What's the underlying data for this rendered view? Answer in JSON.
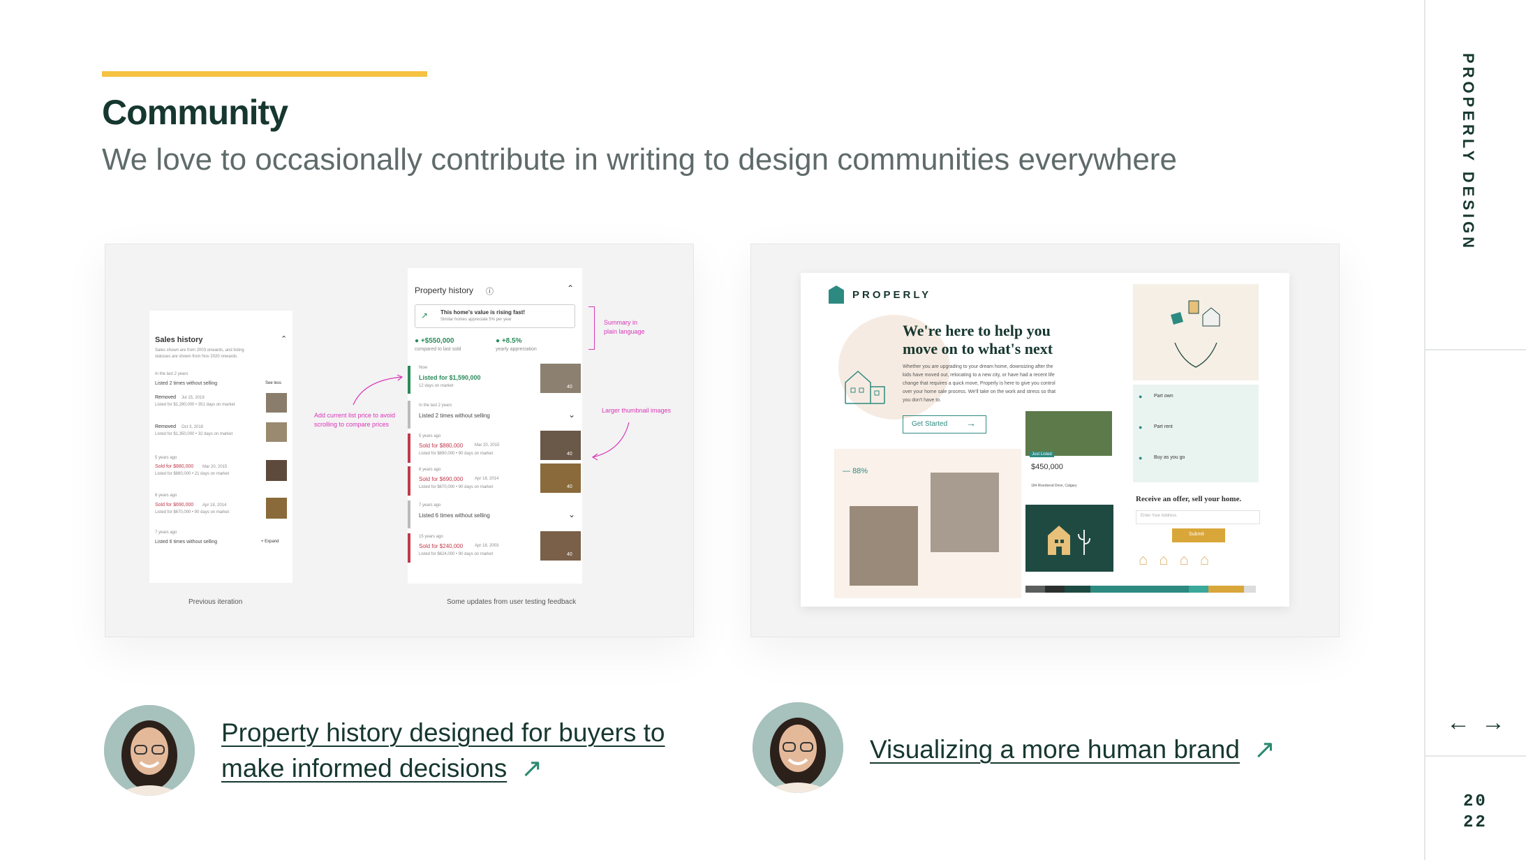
{
  "header": {
    "title": "Community",
    "subtitle": "We love to occasionally contribute in writing to design communities everywhere"
  },
  "sidebar": {
    "brand": "PROPERLY DESIGN",
    "prev_icon": "arrow-left-icon",
    "next_icon": "arrow-right-icon",
    "year_top": "20",
    "year_bottom": "22"
  },
  "articles": [
    {
      "link_line1": "Property history designed for buyers to",
      "link_line2": "make informed decisions",
      "icon": "arrow-up-right-icon"
    },
    {
      "link_line1": "Visualizing a more human brand",
      "icon": "arrow-up-right-icon"
    }
  ],
  "left_card": {
    "sales_history": {
      "title": "Sales history",
      "desc1": "Sales shown are from 2003 onwards, and listing",
      "desc2": "statuses are shown from Nov 2020 onwards.",
      "last2": "In the last 2 years",
      "listed2": "Listed 2 times without selling",
      "see_less": "See less",
      "removed1": "Removed",
      "removed1_date": "Jul 15, 2019",
      "removed1_detail": "Listed for $1,290,000 • 351 days on market",
      "removed2": "Removed",
      "removed2_date": "Oct 3, 2018",
      "removed2_detail": "Listed for $1,350,000 • 32 days on market",
      "ago5": "5 years ago",
      "sold1": "Sold for $880,000",
      "sold1_date": "Mar 20, 2015",
      "sold1_detail": "Listed for $880,000 • 21 days on market",
      "ago6": "6 years ago",
      "sold2": "Sold for $690,000",
      "sold2_date": "Apr 18, 2014",
      "sold2_detail": "Listed for $670,000 • 90 days on market",
      "ago7": "7 years ago",
      "listed6": "Listed 6 times without selling",
      "expand": "Expand"
    },
    "property_history": {
      "title": "Property history",
      "rising": "This home's value is rising fast!",
      "similar": "Similar homes appreciate 5% per year",
      "gain": "+$550,000",
      "gain_label": "compared to last sold",
      "pct": "+8.5%",
      "pct_label": "yearly appreciation",
      "now": "Now",
      "listed_now": "Listed for $1,590,000",
      "listed_now_detail": "12 days on market",
      "last2": "In the last 2 years",
      "listed2": "Listed 2 times without selling",
      "ago5": "5 years ago",
      "sold1": "Sold for $880,000",
      "sold1_date": "Mar 20, 2015",
      "sold1_detail": "Listed for $890,000 • 90 days on market",
      "ago6": "6 years ago",
      "sold2": "Sold for $690,000",
      "sold2_date": "Apr 18, 2014",
      "sold2_detail": "Listed for $670,000 • 90 days on market",
      "ago7": "7 years ago",
      "listed6": "Listed 6 times without selling",
      "ago15": "15 years ago",
      "sold3": "Sold for $240,000",
      "sold3_date": "Apr 18, 2003",
      "sold3_detail": "Listed for $624,000 • 90 days on market",
      "thumb_count": "40"
    },
    "annotations": {
      "summary1": "Summary in",
      "summary2": "plain language",
      "add1": "Add current list price to avoid",
      "add2": "scrolling to compare prices",
      "larger": "Larger thumbnail images"
    },
    "captions": {
      "previous": "Previous iteration",
      "updates": "Some updates from user testing feedback"
    }
  },
  "right_card": {
    "logo": "PROPERLY",
    "headline1": "We're here to help you",
    "headline2": "move on to what's next",
    "body1": "Whether you are upgrading to your dream home, downsizing after the",
    "body2": "kids have moved out, relocating to a new city, or have had a recent life",
    "body3": "change that requires a quick move, Properly is here to give you control",
    "body4": "over your home sale process. We'll take on the work and stress so that",
    "body5": "you don't have to.",
    "cta": "Get Started",
    "stat": "88%",
    "price": "$450,000",
    "address": "184 Riverbend Drive, Calgary",
    "just_listed": "Just Listed",
    "part_own": "Part own",
    "part_rent": "Part rent",
    "buy_as_you_go": "Buy as you go",
    "offer": "Receive an offer, sell your home.",
    "email_placeholder": "Enter Your Address",
    "submit": "Submit",
    "palette": [
      "#5a5f5e",
      "#2b2f2e",
      "#1d4a42",
      "#2d8a80",
      "#3aa89a",
      "#d9a63a",
      "#dcdcdc"
    ]
  }
}
